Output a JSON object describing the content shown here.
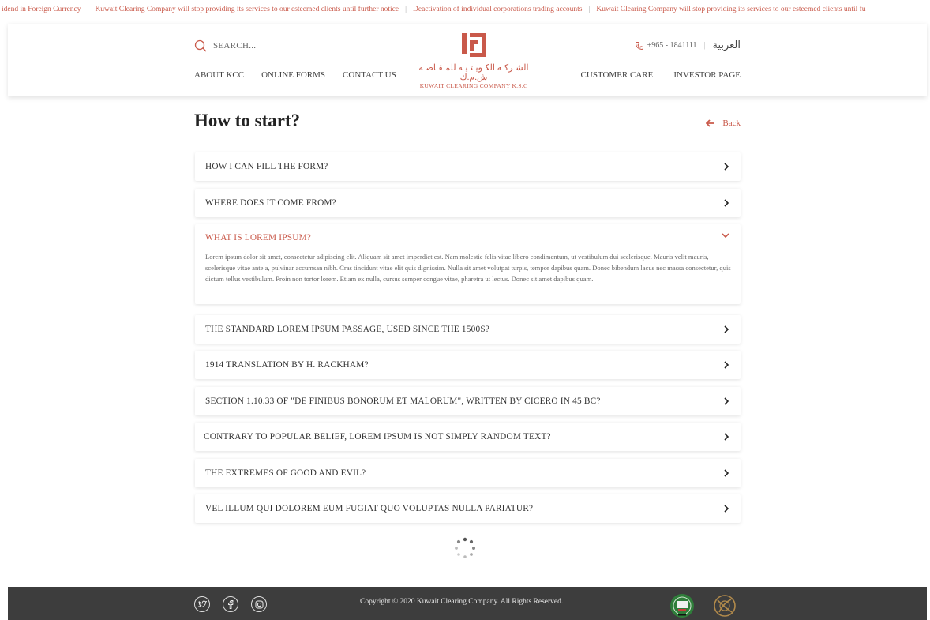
{
  "ticker": {
    "items": [
      "idend in Foreign Currency",
      "Kuwait Clearing Company will stop providing its services to our esteemed clients until further notice",
      "Deactivation of individual corporations trading accounts",
      "Kuwait Clearing Company will stop providing its services to our esteemed clients until fu"
    ],
    "separator": "|"
  },
  "header": {
    "search_label": "SEARCH...",
    "nav_left": [
      "ABOUT KCC",
      "ONLINE FORMS",
      "CONTACT US"
    ],
    "logo_ar": "الشـركـة الكـويـتـيـة للمـقـاصـة ش.م.ك",
    "logo_en": "KUWAIT CLEARING COMPANY K.S.C",
    "phone": "+965 - 1841111",
    "divider": "|",
    "language": "العربية",
    "nav_right": [
      "CUSTOMER CARE",
      "INVESTOR PAGE"
    ]
  },
  "main": {
    "title": "How to start?",
    "back_label": "Back"
  },
  "faq": [
    {
      "question": "HOW I CAN FILL THE FORM?"
    },
    {
      "question": "WHERE DOES IT COME FROM?"
    },
    {
      "question": "WHAT IS LOREM IPSUM?",
      "answer": "Lorem ipsum dolor sit amet, consectetur adipiscing elit. Aliquam sit amet imperdiet est. Nam molestie felis vitae libero condimentum, ut vestibulum dui scelerisque. Mauris velit mauris, scelerisque vitae ante a, pulvinar accumsan nibh. Cras tincidunt vitae elit quis dignissim. Nulla sit amet volutpat turpis, tempor dapibus quam. Donec bibendum lacus nec massa consectetur, quis dictum tellus vestibulum. Proin non tortor lorem. Etiam ex nulla, cursus semper congue vitae, pharetra ut lectus. Donec sit amet dapibus quam."
    },
    {
      "question": "THE STANDARD LOREM IPSUM PASSAGE, USED SINCE THE 1500S?"
    },
    {
      "question": "1914 TRANSLATION BY H. RACKHAM?"
    },
    {
      "question": "SECTION 1.10.33 OF \"DE FINIBUS BONORUM ET MALORUM\", WRITTEN BY CICERO IN 45 BC?"
    },
    {
      "question": "CONTRARY TO POPULAR BELIEF, LOREM IPSUM IS NOT SIMPLY RANDOM TEXT?"
    },
    {
      "question": "THE EXTREMES OF GOOD AND EVIL?"
    },
    {
      "question": "VEL ILLUM QUI DOLOREM EUM FUGIAT QUO VOLUPTAS NULLA PARIATUR?"
    }
  ],
  "footer": {
    "copyright": "Copyright © 2020 Kuwait Clearing Company. All Rights Reserved.",
    "social_icons": [
      "twitter-icon",
      "facebook-icon",
      "instagram-icon"
    ]
  },
  "colors": {
    "accent": "#c9594a",
    "footer_bg": "#3d3d3d",
    "text": "#333333"
  }
}
